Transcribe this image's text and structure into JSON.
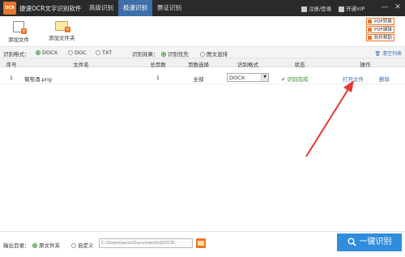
{
  "titlebar": {
    "logo_text": "OCR",
    "app_name": "捷速OCR文字识别软件",
    "menus": [
      "高级识别",
      "极速识别",
      "票证识别"
    ],
    "active_menu": "极速识别",
    "login": "注册/登录",
    "vip": "开通VIP",
    "minimize": "—",
    "close": "✕"
  },
  "toolbar": {
    "add_file": "添加文件",
    "add_folder": "添加文件夹",
    "side_links": [
      "PDF转换",
      "PDF编辑",
      "软件帮助"
    ]
  },
  "options": {
    "format_label": "识别格式：",
    "formats": [
      "DOCX",
      "DOC",
      "TXT"
    ],
    "selected_format": "DOCX",
    "effect_label": "识别效果：",
    "effects": [
      "识别优先",
      "图文混排"
    ],
    "selected_effect": "识别优先",
    "clear_list": "清空列表"
  },
  "table": {
    "headers": [
      "序号",
      "文件名",
      "总页数",
      "页数选择",
      "识别格式",
      "状态",
      "操作"
    ],
    "rows": [
      {
        "index": "1",
        "filename": "葡萄酒.png",
        "pages": "1",
        "page_select": "全部",
        "format": "DOCX",
        "status": "✔ 识别完成",
        "open": "打开文件",
        "delete": "删除"
      }
    ]
  },
  "bottom": {
    "output_label": "输出目录：",
    "option_original": "原文件夹",
    "option_custom": "自定义",
    "path": "C:\\Users\\asus\\Documents\\JSOCR\\",
    "ocr_button": "一键识别"
  },
  "colors": {
    "titlebar_bg": "#2a2a2a",
    "active_menu_bg": "#3f6ea8",
    "accent_orange": "#e8762c",
    "ocr_button_bg": "#2f8ddb",
    "annotation_arrow": "#e53935"
  }
}
